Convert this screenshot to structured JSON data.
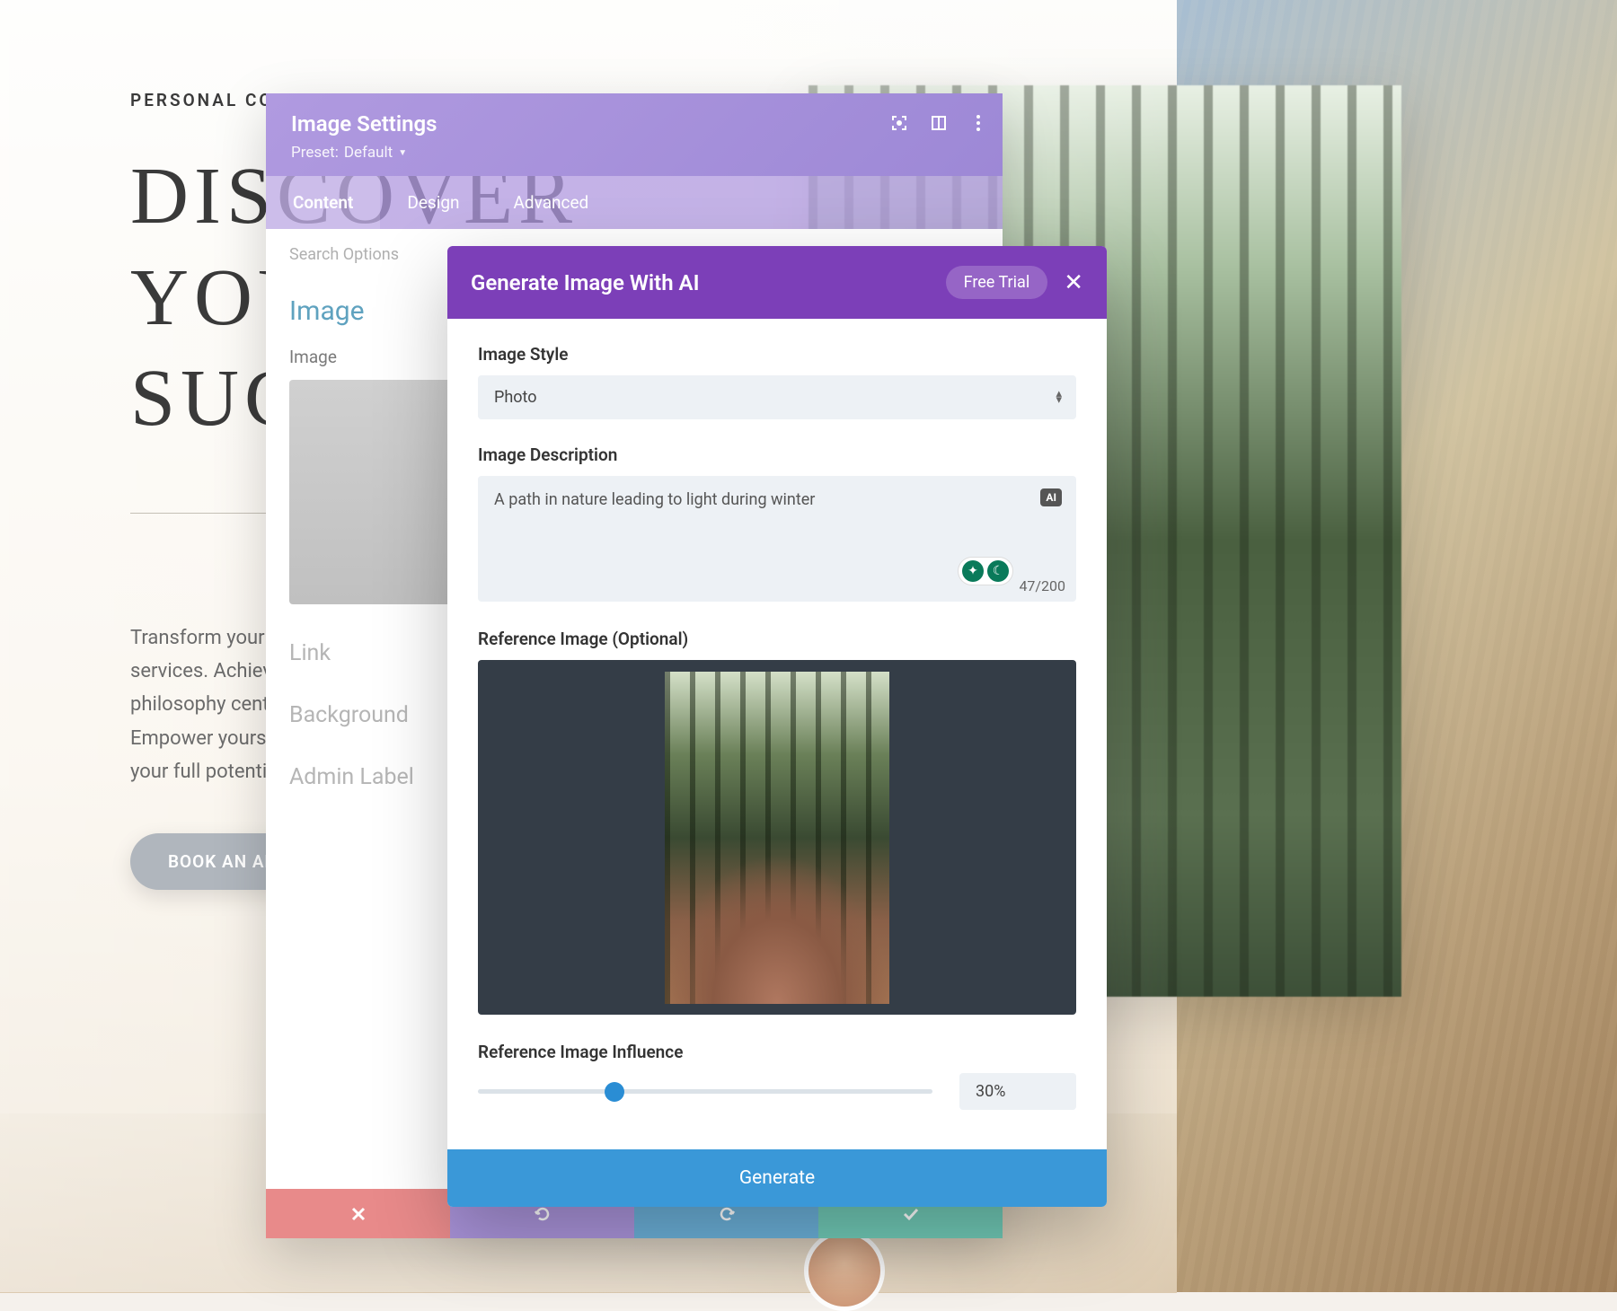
{
  "page": {
    "eyebrow": "PERSONAL COACH",
    "headline": "DISCOVER YOUR SUCCESS",
    "body": "Transform your life with personalized coaching services. Achieve your goals at your own pace. Our philosophy centers around holistic growth and balance. Empower yourself with expert guidance and unlock your full potential.",
    "cta": "BOOK AN APPOINTMENT"
  },
  "settings": {
    "title": "Image Settings",
    "preset_label": "Preset:",
    "preset_value": "Default",
    "tabs": {
      "content": "Content",
      "design": "Design",
      "advanced": "Advanced"
    },
    "search_placeholder": "Search Options",
    "section_image": "Image",
    "label_image": "Image",
    "section_link": "Link",
    "section_background": "Background",
    "section_admin": "Admin Label"
  },
  "ai": {
    "title": "Generate Image With AI",
    "free_trial": "Free Trial",
    "style_label": "Image Style",
    "style_value": "Photo",
    "desc_label": "Image Description",
    "desc_value": "A path in nature leading to light during winter",
    "counter": "47/200",
    "ai_badge": "AI",
    "ref_label": "Reference Image (Optional)",
    "influence_label": "Reference Image Influence",
    "influence_value": "30%",
    "influence_percent": 30,
    "generate": "Generate"
  }
}
